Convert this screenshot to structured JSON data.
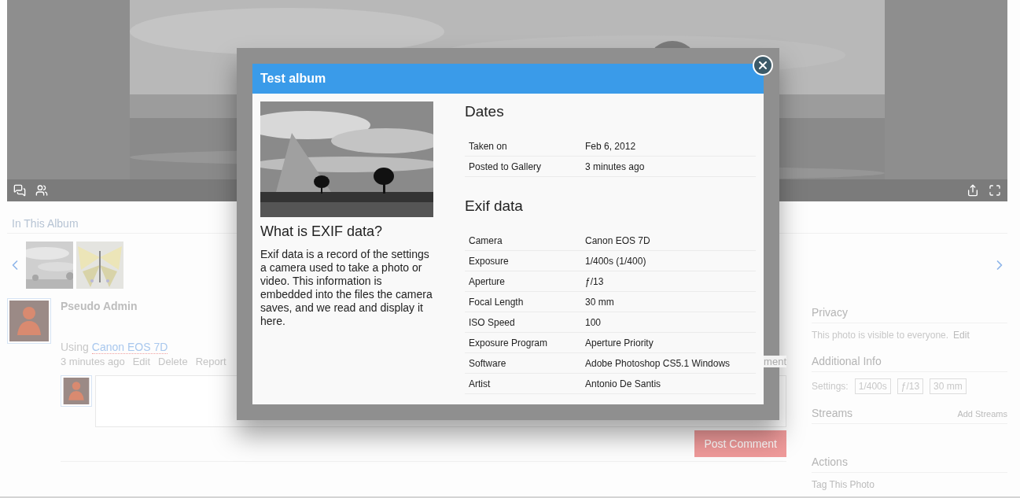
{
  "album": {
    "heading": "In This Album"
  },
  "comment": {
    "author": "Pseudo Admin",
    "using": "Using",
    "camera": "Canon EOS 7D",
    "time": "3 minutes ago",
    "actions": [
      "Edit",
      "Delete",
      "Report"
    ],
    "partial_link": "ment",
    "post_button": "Post Comment"
  },
  "sidebar": {
    "privacy": {
      "title": "Privacy",
      "text": "This photo is visible to everyone.",
      "edit": "Edit"
    },
    "info": {
      "title": "Additional Info",
      "settings_label": "Settings:",
      "tags": [
        "1/400s",
        "ƒ/13",
        "30 mm"
      ]
    },
    "streams": {
      "title": "Streams",
      "action": "Add Streams"
    },
    "actions": {
      "title": "Actions",
      "items": [
        "Tag This Photo"
      ]
    }
  },
  "modal": {
    "title": "Test album",
    "heading": "What is EXIF data?",
    "description": "Exif data is a record of the settings a camera used to take a photo or video. This information is embedded into the files the camera saves, and we read and display it here.",
    "sections": [
      {
        "title": "Dates",
        "rows": [
          {
            "label": "Taken on",
            "value": "Feb 6, 2012"
          },
          {
            "label": "Posted to Gallery",
            "value": "3 minutes ago"
          }
        ]
      },
      {
        "title": "Exif data",
        "rows": [
          {
            "label": "Camera",
            "value": "Canon EOS 7D"
          },
          {
            "label": "Exposure",
            "value": "1/400s (1/400)"
          },
          {
            "label": "Aperture",
            "value": "ƒ/13"
          },
          {
            "label": "Focal Length",
            "value": "30 mm"
          },
          {
            "label": "ISO Speed",
            "value": "100"
          },
          {
            "label": "Exposure Program",
            "value": "Aperture Priority"
          },
          {
            "label": "Software",
            "value": "Adobe Photoshop CS5.1 Windows"
          },
          {
            "label": "Artist",
            "value": "Antonio De Santis"
          }
        ]
      }
    ]
  }
}
